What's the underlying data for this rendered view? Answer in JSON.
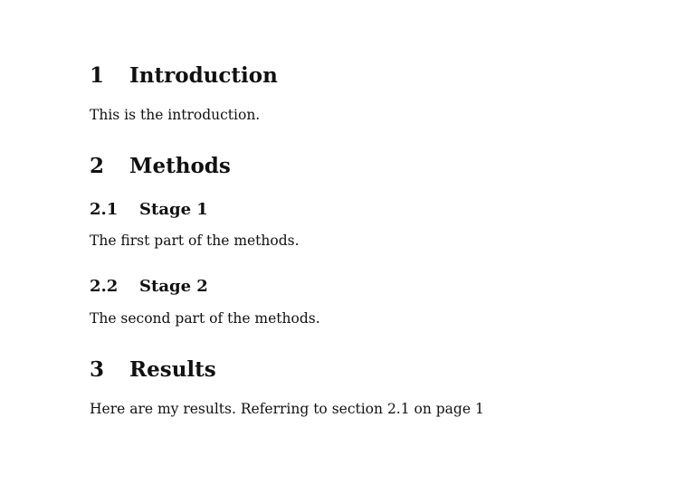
{
  "sections": [
    {
      "number": "1",
      "title": "Introduction",
      "body": "This is the introduction."
    },
    {
      "number": "2",
      "title": "Methods",
      "subsections": [
        {
          "number": "2.1",
          "title": "Stage 1",
          "body": "The first part of the methods."
        },
        {
          "number": "2.2",
          "title": "Stage 2",
          "body": "The second part of the methods."
        }
      ]
    },
    {
      "number": "3",
      "title": "Results",
      "body_prefix": "Here are my results. Referring to section ",
      "ref_section": "2.1",
      "body_mid": " on page ",
      "ref_page": "1"
    }
  ]
}
